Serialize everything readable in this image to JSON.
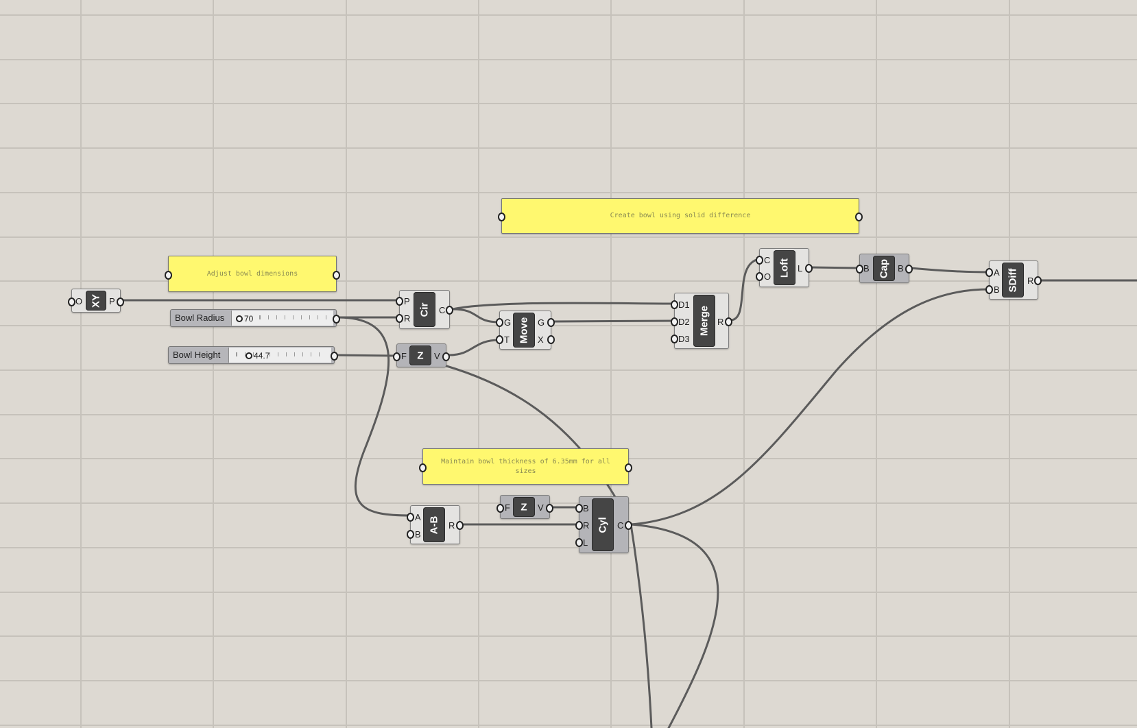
{
  "canvas": {
    "background": "#ddd9d2",
    "gridline_color": "#c6c2bb",
    "wire_color": "#5b5b5b",
    "note_color": "#fff86f"
  },
  "notes": {
    "adjust": "Adjust bowl dimensions",
    "create": "Create bowl using solid difference",
    "maintain": "Maintain bowl thickness of 6.35mm for all sizes"
  },
  "sliders": {
    "radius": {
      "label": "Bowl Radius",
      "value": "70"
    },
    "height": {
      "label": "Bowl Height",
      "value": "44.7"
    }
  },
  "components": {
    "xy": {
      "name": "XY",
      "inputs": [
        "O"
      ],
      "outputs": [
        "P"
      ]
    },
    "cir": {
      "name": "Cir",
      "inputs": [
        "P",
        "R"
      ],
      "outputs": [
        "C"
      ]
    },
    "z1": {
      "name": "Z",
      "inputs": [
        "F"
      ],
      "outputs": [
        "V"
      ]
    },
    "move": {
      "name": "Move",
      "inputs": [
        "G",
        "T"
      ],
      "outputs": [
        "G",
        "X"
      ]
    },
    "merge": {
      "name": "Merge",
      "inputs": [
        "D1",
        "D2",
        "D3"
      ],
      "outputs": [
        "R"
      ]
    },
    "loft": {
      "name": "Loft",
      "inputs": [
        "C",
        "O"
      ],
      "outputs": [
        "L"
      ]
    },
    "cap": {
      "name": "Cap",
      "inputs": [
        "B"
      ],
      "outputs": [
        "B"
      ]
    },
    "sdiff": {
      "name": "SDiff",
      "inputs": [
        "A",
        "B"
      ],
      "outputs": [
        "R"
      ]
    },
    "amb": {
      "name": "A-B",
      "inputs": [
        "A",
        "B"
      ],
      "outputs": [
        "R"
      ]
    },
    "z2": {
      "name": "Z",
      "inputs": [
        "F"
      ],
      "outputs": [
        "V"
      ]
    },
    "cyl": {
      "name": "Cyl",
      "inputs": [
        "B",
        "R",
        "L"
      ],
      "outputs": [
        "C"
      ]
    }
  }
}
